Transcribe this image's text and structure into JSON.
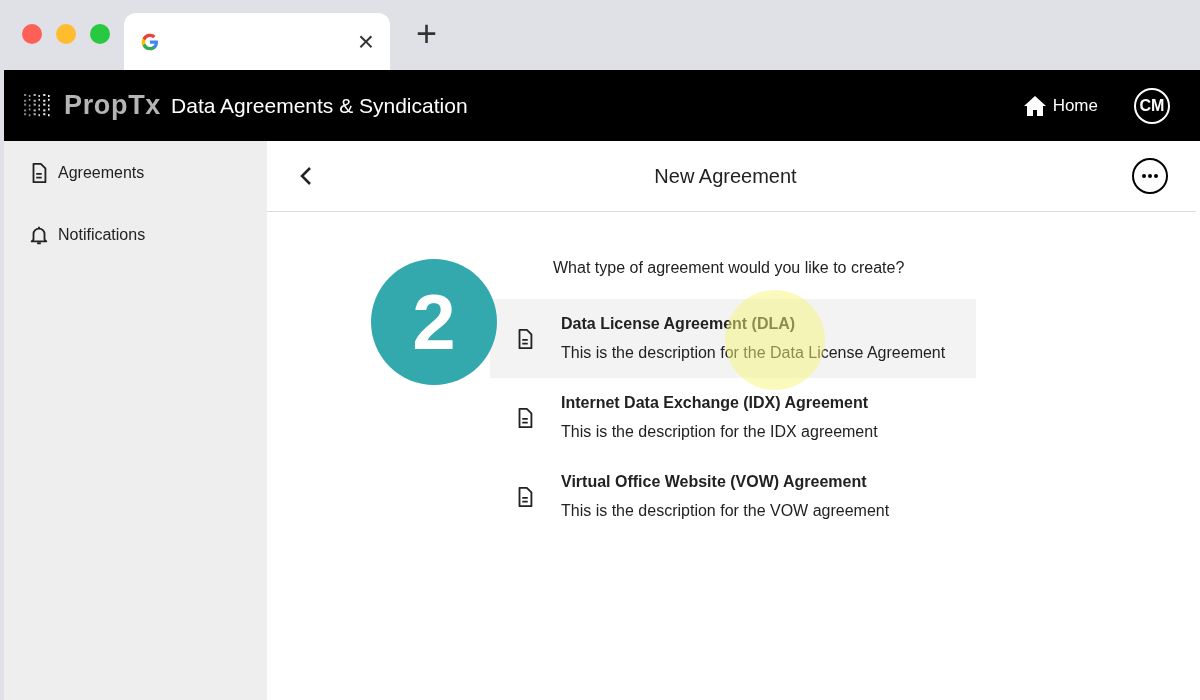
{
  "browser": {
    "tab_close": "×",
    "new_tab": "+"
  },
  "header": {
    "brand": "PropTx",
    "title": "Data Agreements & Syndication",
    "home": "Home",
    "avatar": "CM"
  },
  "sidebar": {
    "items": [
      {
        "label": "Agreements",
        "kind": "document"
      },
      {
        "label": "Notifications",
        "kind": "bell"
      }
    ]
  },
  "page": {
    "title": "New Agreement",
    "question": "What type of agreement would you like to create?",
    "step_badge": "2",
    "options": [
      {
        "title": "Data License Agreement (DLA)",
        "description": "This is the description for the Data License Agreement",
        "selected": true
      },
      {
        "title": "Internet Data Exchange (IDX) Agreement",
        "description": "This is the description for the IDX agreement",
        "selected": false
      },
      {
        "title": "Virtual Office Website (VOW) Agreement",
        "description": "This is the description for the VOW agreement",
        "selected": false
      }
    ]
  }
}
